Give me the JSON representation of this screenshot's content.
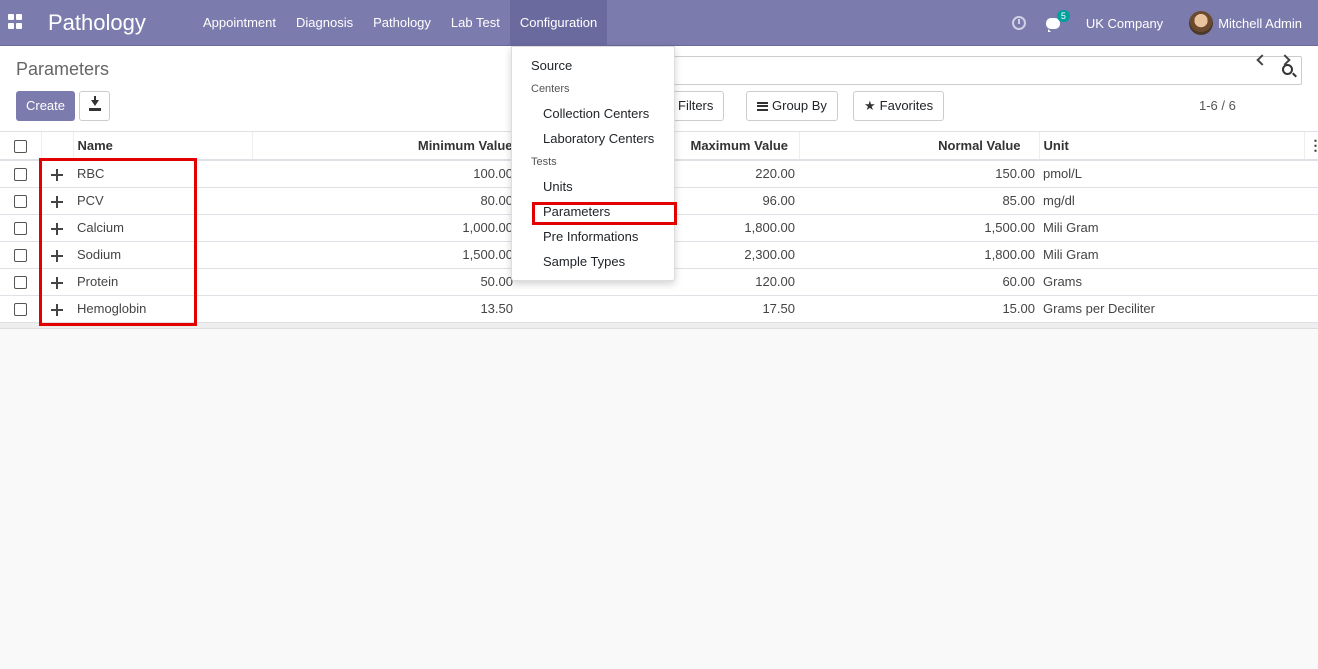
{
  "navbar": {
    "brand": "Pathology",
    "menu": [
      "Appointment",
      "Diagnosis",
      "Pathology",
      "Lab Test",
      "Configuration"
    ],
    "active_menu": "Configuration",
    "chat_count": "5",
    "company": "UK Company",
    "user": "Mitchell Admin"
  },
  "control": {
    "title": "Parameters",
    "create_label": "Create",
    "search_placeholder": "Search...",
    "filters_label": "Filters",
    "groupby_label": "Group By",
    "favorites_label": "Favorites",
    "pager": "1-6 / 6"
  },
  "table": {
    "columns": [
      "Name",
      "Minimum Value",
      "Maximum Value",
      "Normal Value",
      "Unit"
    ],
    "rows": [
      {
        "name": "RBC",
        "min": "100.00",
        "max": "220.00",
        "normal": "150.00",
        "unit": "pmol/L"
      },
      {
        "name": "PCV",
        "min": "80.00",
        "max": "96.00",
        "normal": "85.00",
        "unit": "mg/dl"
      },
      {
        "name": "Calcium",
        "min": "1,000.00",
        "max": "1,800.00",
        "normal": "1,500.00",
        "unit": "Mili Gram"
      },
      {
        "name": "Sodium",
        "min": "1,500.00",
        "max": "2,300.00",
        "normal": "1,800.00",
        "unit": "Mili Gram"
      },
      {
        "name": "Protein",
        "min": "50.00",
        "max": "120.00",
        "normal": "60.00",
        "unit": "Grams"
      },
      {
        "name": "Hemoglobin",
        "min": "13.50",
        "max": "17.50",
        "normal": "15.00",
        "unit": "Grams per Deciliter"
      }
    ]
  },
  "dropdown": {
    "source": "Source",
    "centers_header": "Centers",
    "collection_centers": "Collection Centers",
    "laboratory_centers": "Laboratory Centers",
    "tests_header": "Tests",
    "units": "Units",
    "parameters": "Parameters",
    "pre_informations": "Pre Informations",
    "sample_types": "Sample Types"
  },
  "colors": {
    "navbar": "#7c7bad",
    "highlight": "#e30000"
  }
}
